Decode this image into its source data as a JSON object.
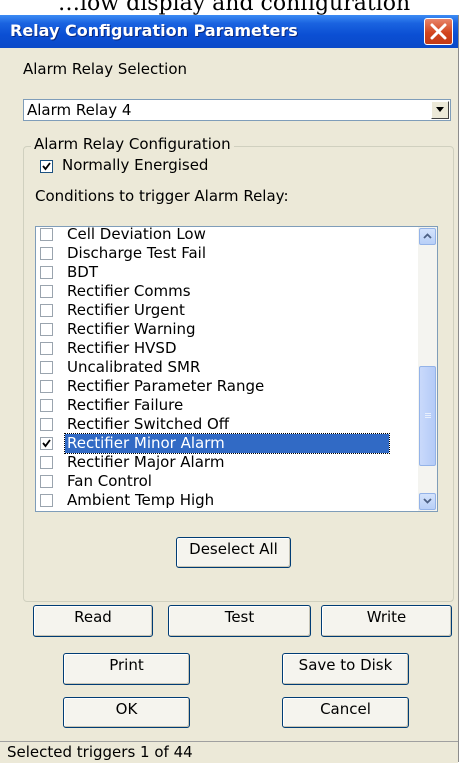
{
  "background_fragment": "…low display and configuration",
  "window": {
    "title": "Relay Configuration Parameters"
  },
  "alarm_relay_selection": {
    "label": "Alarm Relay Selection",
    "selected": "Alarm Relay 4"
  },
  "config_group": {
    "title": "Alarm Relay Configuration",
    "normally_energised": {
      "label": "Normally Energised",
      "checked": true
    },
    "conditions_label": "Conditions to trigger Alarm Relay:",
    "conditions": [
      {
        "label": "Cell Deviation Low",
        "checked": false
      },
      {
        "label": "Discharge Test Fail",
        "checked": false
      },
      {
        "label": "BDT",
        "checked": false
      },
      {
        "label": "Rectifier Comms",
        "checked": false
      },
      {
        "label": "Rectifier Urgent",
        "checked": false
      },
      {
        "label": "Rectifier Warning",
        "checked": false
      },
      {
        "label": "Rectifier HVSD",
        "checked": false
      },
      {
        "label": "Uncalibrated SMR",
        "checked": false
      },
      {
        "label": "Rectifier Parameter Range",
        "checked": false
      },
      {
        "label": "Rectifier Failure",
        "checked": false
      },
      {
        "label": "Rectifier Switched Off",
        "checked": false
      },
      {
        "label": "Rectifier Minor Alarm",
        "checked": true,
        "selected": true
      },
      {
        "label": "Rectifier Major Alarm",
        "checked": false
      },
      {
        "label": "Fan Control",
        "checked": false
      },
      {
        "label": "Ambient Temp High",
        "checked": false
      }
    ],
    "deselect_all": "Deselect All"
  },
  "buttons": {
    "read": "Read",
    "test": "Test",
    "write": "Write",
    "print": "Print",
    "save_to_disk": "Save to Disk",
    "ok": "OK",
    "cancel": "Cancel"
  },
  "status": {
    "text": "Selected triggers 1 of 44"
  },
  "colors": {
    "title_bar": "#0a4fd4",
    "dialog_bg": "#ece9d8",
    "selection": "#316ac5",
    "close_button": "#d2451e"
  }
}
